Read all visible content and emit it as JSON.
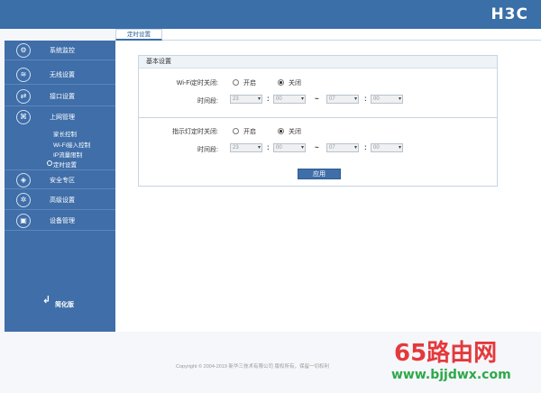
{
  "brand": {
    "logo": "H3C"
  },
  "tabs": [
    {
      "label": "定时设置"
    }
  ],
  "sidebar": {
    "items": [
      {
        "label": "系统监控",
        "icon": "monitor-icon",
        "glyph": "⚙"
      },
      {
        "label": "无线设置",
        "icon": "wireless-icon",
        "glyph": "≋"
      },
      {
        "label": "接口设置",
        "icon": "interface-icon",
        "glyph": "⇄"
      },
      {
        "label": "上网管理",
        "icon": "internet-icon",
        "glyph": "⌘"
      },
      {
        "label": "安全专区",
        "icon": "shield-icon",
        "glyph": "◈"
      },
      {
        "label": "高级设置",
        "icon": "settings-icon",
        "glyph": "✲"
      },
      {
        "label": "设备管理",
        "icon": "device-icon",
        "glyph": "▣"
      }
    ],
    "subitems": [
      "家长控制",
      "Wi-Fi接入控制",
      "IP流量限制",
      "定时设置"
    ],
    "simple_mode": "简化版"
  },
  "panel": {
    "title": "基本设置",
    "wifi": {
      "label": "Wi-Fi定时关闭:",
      "on_label": "开启",
      "off_label": "关闭",
      "selected": "关闭",
      "time_label": "时间段:",
      "start_hour": "23",
      "start_min": "00",
      "end_hour": "07",
      "end_min": "00"
    },
    "led": {
      "label": "指示灯定时关闭:",
      "on_label": "开启",
      "off_label": "关闭",
      "selected": "关闭",
      "time_label": "时间段:",
      "start_hour": "23",
      "start_min": "00",
      "end_hour": "07",
      "end_min": "00"
    },
    "sep_colon": ":",
    "sep_tilde": "~",
    "apply": "应用"
  },
  "footer": {
    "copyright": "Copyright © 2004-2019 新华三技术有限公司 版权所有，保留一切权利"
  },
  "watermark": {
    "main": "65路由网",
    "url": "www.bjjdwx.com"
  }
}
